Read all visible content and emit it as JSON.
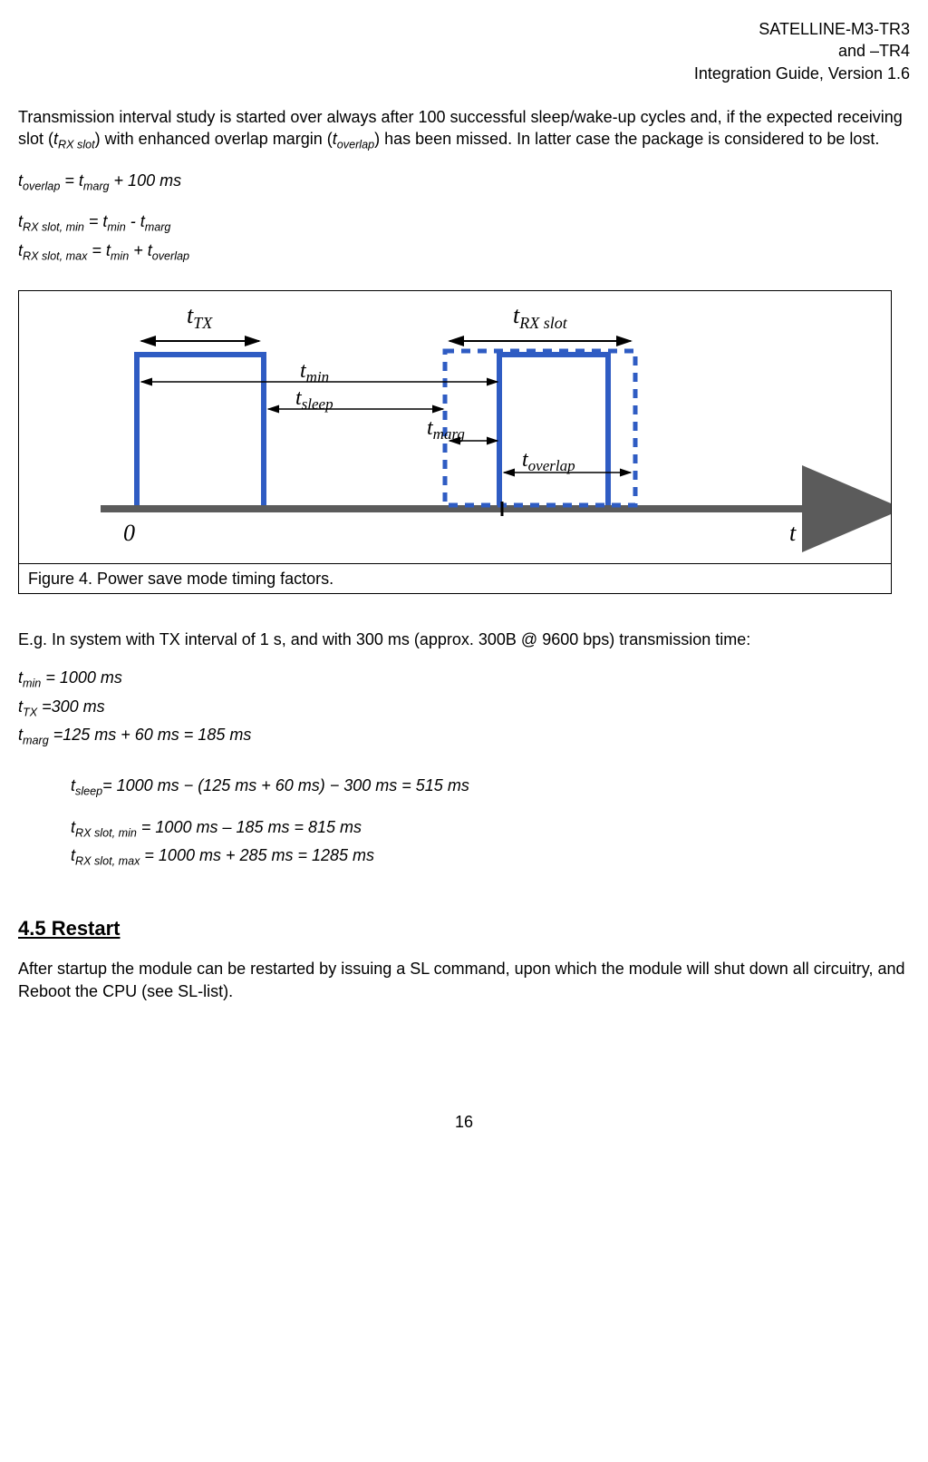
{
  "header": {
    "line1": "SATELLINE-M3-TR3",
    "line2": "and –TR4",
    "line3": "Integration Guide, Version 1.6"
  },
  "intro": {
    "p1a": "Transmission interval study is started over always after 100 successful sleep/wake-up cycles and, if the expected receiving slot (",
    "p1b": ") with enhanced overlap margin (",
    "p1c": ") has been missed. In latter case the package is considered to be lost.",
    "sub1": "RX slot",
    "sub2": "overlap"
  },
  "equations": {
    "e1": "t",
    "e1s": "overlap",
    "e1m": " = t",
    "e1s2": "marg",
    "e1end": " + 100 ms",
    "e2": "t",
    "e2s": "RX slot, min",
    "e2m": " = t",
    "e2s2": "min",
    "e2mid": " - t",
    "e2s3": "marg",
    "e3": "t",
    "e3s": "RX slot, max",
    "e3m": " = t",
    "e3s2": "min",
    "e3mid": " + t",
    "e3s3": "overlap"
  },
  "figure": {
    "label_tTX": "t",
    "label_tTX_sub": "TX",
    "label_tRX": "t",
    "label_tRX_sub": "RX slot",
    "label_tmin": "t",
    "label_tmin_sub": "min",
    "label_tsleep": "t",
    "label_tsleep_sub": "sleep",
    "label_tmarg": "t",
    "label_tmarg_sub": "marg",
    "label_toverlap": "t",
    "label_toverlap_sub": "overlap",
    "axis_zero": "0",
    "axis_t": "t",
    "caption": "Figure 4.  Power save mode timing factors."
  },
  "example": {
    "intro": "E.g. In system with TX interval of 1 s, and with 300 ms (approx. 300B @ 9600 bps) transmission time:",
    "l1a": "t",
    "l1s": "min",
    "l1b": " = 1000 ms",
    "l2a": " t",
    "l2s": "TX",
    "l2b": " =300 ms",
    "l3a": "t",
    "l3s": "marg",
    "l3b": " =125 ms + 60 ms = 185 ms",
    "l4a": "t",
    "l4s": "sleep",
    "l4b": "= 1000 ms − (125 ms + 60 ms) − 300 ms = 515 ms",
    "l5a": "t",
    "l5s": "RX slot, min",
    "l5b": " = 1000 ms – 185 ms = 815 ms",
    "l6a": "t",
    "l6s": "RX slot, max",
    "l6b": " = 1000 ms + 285 ms = 1285 ms"
  },
  "section45": {
    "heading": "4.5  Restart",
    "body": "After startup the module can be restarted by issuing a SL command, upon which the module will shut down all circuitry, and Reboot the CPU (see SL-list)."
  },
  "page_number": "16"
}
